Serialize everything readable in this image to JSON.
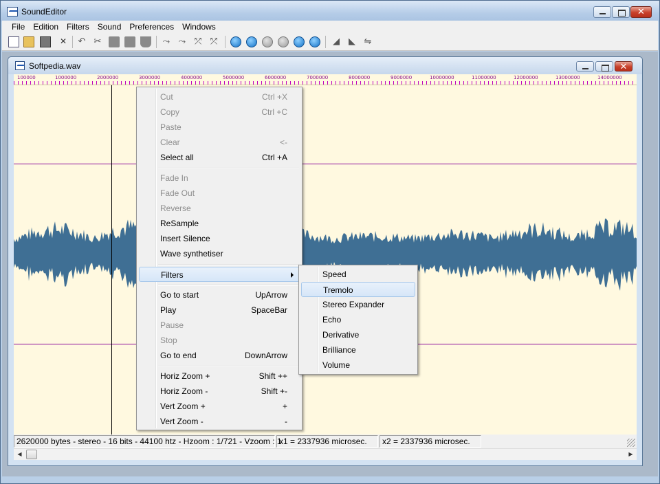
{
  "app": {
    "title": "SoundEditor"
  },
  "menubar": [
    "File",
    "Edition",
    "Filters",
    "Sound",
    "Preferences",
    "Windows"
  ],
  "toolbar": {
    "icons": [
      "new-wave-icon",
      "open-folder-icon",
      "save-icon",
      "close-icon",
      "undo-icon",
      "cut-icon",
      "copy-icon",
      "paste-icon",
      "clear-icon",
      "go-to-start-icon",
      "play-icon",
      "pause-icon",
      "stop-icon",
      "go-to-end-icon",
      "record-icon",
      "fade-in-icon",
      "fade-out-icon",
      "reverse-icon"
    ]
  },
  "document": {
    "title": "Softpedia.wav"
  },
  "ruler": [
    "100000",
    "1000000",
    "2000000",
    "3000000",
    "4000000",
    "5000000",
    "6000000",
    "7000000",
    "8000000",
    "9000000",
    "10000000",
    "11000000",
    "12000000",
    "13000000",
    "14000000"
  ],
  "context_menu": {
    "items": [
      {
        "label": "Cut",
        "shortcut": "Ctrl +X",
        "enabled": false
      },
      {
        "label": "Copy",
        "shortcut": "Ctrl +C",
        "enabled": false
      },
      {
        "label": "Paste",
        "shortcut": "",
        "enabled": false
      },
      {
        "label": "Clear",
        "shortcut": "<-",
        "enabled": false
      },
      {
        "label": "Select all",
        "shortcut": "Ctrl +A",
        "enabled": true
      },
      {
        "label": "Fade In",
        "shortcut": "",
        "enabled": false
      },
      {
        "label": "Fade Out",
        "shortcut": "",
        "enabled": false
      },
      {
        "label": "Reverse",
        "shortcut": "",
        "enabled": false
      },
      {
        "label": "ReSample",
        "shortcut": "",
        "enabled": true
      },
      {
        "label": "Insert Silence",
        "shortcut": "",
        "enabled": true
      },
      {
        "label": "Wave synthetiser",
        "shortcut": "",
        "enabled": true
      },
      {
        "label": "Filters",
        "shortcut": "",
        "enabled": true,
        "submenu": true,
        "highlighted": true
      },
      {
        "label": "Go to start",
        "shortcut": "UpArrow",
        "enabled": true
      },
      {
        "label": "Play",
        "shortcut": "SpaceBar",
        "enabled": true
      },
      {
        "label": "Pause",
        "shortcut": "",
        "enabled": false
      },
      {
        "label": "Stop",
        "shortcut": "",
        "enabled": false
      },
      {
        "label": "Go to end",
        "shortcut": "DownArrow",
        "enabled": true
      },
      {
        "label": "Horiz Zoom +",
        "shortcut": "Shift ++",
        "enabled": true
      },
      {
        "label": "Horiz Zoom -",
        "shortcut": "Shift +-",
        "enabled": true
      },
      {
        "label": "Vert Zoom +",
        "shortcut": "+",
        "enabled": true
      },
      {
        "label": "Vert Zoom -",
        "shortcut": "-",
        "enabled": true
      }
    ]
  },
  "filters_submenu": {
    "items": [
      {
        "label": "Speed",
        "highlighted": false
      },
      {
        "label": "Tremolo",
        "highlighted": true
      },
      {
        "label": "Stereo Expander",
        "highlighted": false
      },
      {
        "label": "Echo",
        "highlighted": false
      },
      {
        "label": "Derivative",
        "highlighted": false
      },
      {
        "label": "Brilliance",
        "highlighted": false
      },
      {
        "label": "Volume",
        "highlighted": false
      }
    ]
  },
  "statusbar": {
    "info": "2620000 bytes - stereo - 16 bits - 44100 htz - Hzoom : 1/721 - Vzoom : 1",
    "x1": "x1 = 2337936 microsec.",
    "x2": "x2 = 2337936 microsec."
  },
  "colors": {
    "wave_fill": "#3f6f94",
    "channel_line": "#8a0a9a",
    "wave_background": "#fff9e0"
  }
}
